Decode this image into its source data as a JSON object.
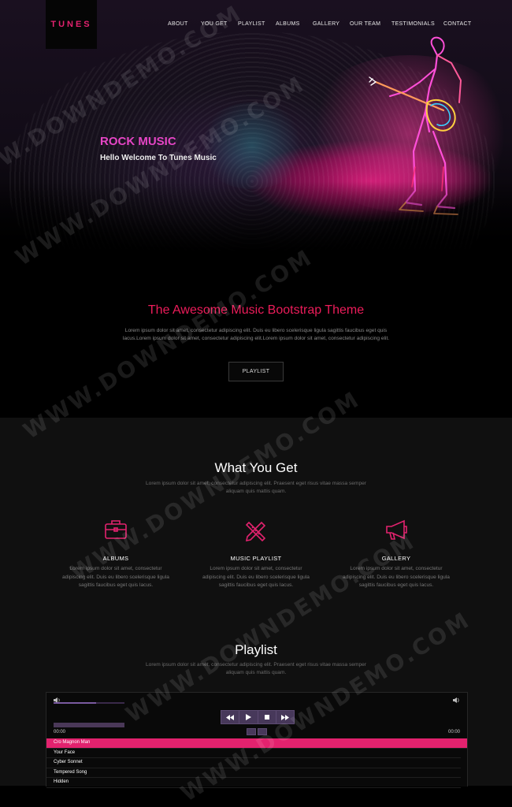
{
  "brand": {
    "logo_text": "TUNES"
  },
  "nav": {
    "items": [
      "ABOUT",
      "YOU GET",
      "PLAYLIST",
      "ALBUMS",
      "GALLERY",
      "OUR TEAM",
      "TESTIMONIALS",
      "CONTACT"
    ]
  },
  "hero": {
    "title": "ROCK MUSIC",
    "subtitle": "Hello Welcome To Tunes Music"
  },
  "intro": {
    "heading": "The Awesome Music Bootstrap Theme",
    "text": "Lorem ipsum dolor sit amet, consectetur adipiscing elit. Duis eu libero scelerisque ligula sagittis faucibus eget quis lacus.Lorem ipsum dolor sit amet, consectetur adipiscing elit.Lorem ipsum dolor sit amet, consectetur adipiscing elit.",
    "button_label": "PLAYLIST"
  },
  "what_you_get": {
    "title": "What You Get",
    "subtitle": "Lorem ipsum dolor sit amet, consectetur adipiscing elit. Praesent eget risus vitae massa semper aliquam quis mattis quam.",
    "features": [
      {
        "icon": "briefcase-icon",
        "title": "ALBUMS",
        "text": "Lorem ipsum dolor sit amet, consectetur adipiscing elit. Duis eu libero scelerisque ligula sagittis faucibus eget quis lacus."
      },
      {
        "icon": "pencil-ruler-icon",
        "title": "MUSIC PLAYLIST",
        "text": "Lorem ipsum dolor sit amet, consectetur adipiscing elit. Duis eu libero scelerisque ligula sagittis faucibus eget quis lacus."
      },
      {
        "icon": "megaphone-icon",
        "title": "GALLERY",
        "text": "Lorem ipsum dolor sit amet, consectetur adipiscing elit. Duis eu libero scelerisque ligula sagittis faucibus eget quis lacus."
      }
    ]
  },
  "playlist": {
    "title": "Playlist",
    "subtitle": "Lorem ipsum dolor sit amet, consectetur adipiscing elit. Praesent eget risus vitae massa semper aliquam quis mattis quam.",
    "player": {
      "current_time": "00:00",
      "total_time": "00:00",
      "tracks": [
        "Cro Magnon Man",
        "Your Face",
        "Cyber Sonnet",
        "Tempered Song",
        "Hidden"
      ],
      "active_track_index": 0
    }
  },
  "watermark": {
    "text": "WWW.DOWNDEMO.COM"
  },
  "colors": {
    "accent": "#e2226e",
    "hero_title": "#e545c5",
    "intro_heading": "#ec1c5a",
    "player_controls": "#47385a"
  }
}
